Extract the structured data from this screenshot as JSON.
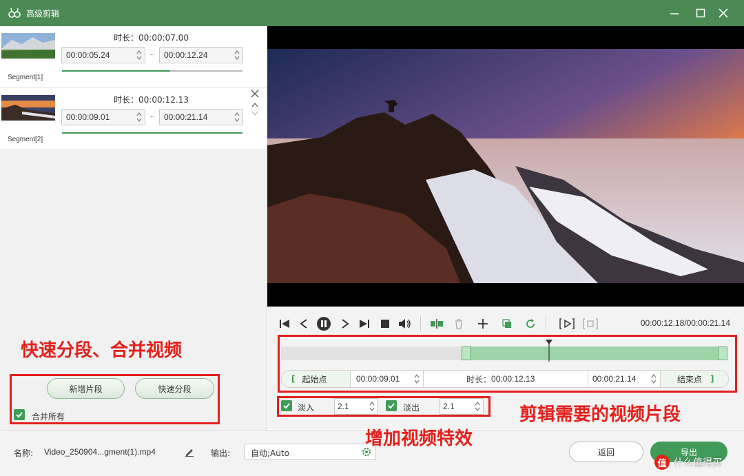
{
  "window": {
    "title": "高级剪辑"
  },
  "segments": [
    {
      "label": "Segment[1]",
      "duration_label": "时长：",
      "duration": "00:00:07.00",
      "start": "00:00:05.24",
      "end": "00:00:12.24",
      "dash": "-",
      "progress_start": 0.0,
      "progress_end": 0.6
    },
    {
      "label": "Segment[2]",
      "duration_label": "时长：",
      "duration": "00:00:12.13",
      "start": "00:00:09.01",
      "end": "00:00:21.14",
      "dash": "-",
      "progress_start": 0.0,
      "progress_end": 1.0
    }
  ],
  "left_actions": {
    "add_segment": "新增片段",
    "quick_split": "快速分段",
    "merge_all": "合并所有",
    "merge_all_checked": true
  },
  "annotations": {
    "quick_split_merge": "快速分段、合并视频",
    "clip_segment": "剪辑需要的视频片段",
    "add_effects": "增加视频特效"
  },
  "player": {
    "time_readout": "00:00:12.18/00:00:21.14",
    "selection_start_fraction": 0.405,
    "selection_end_fraction": 1.0,
    "playhead_fraction": 0.6
  },
  "markers": {
    "start_label": "起始点",
    "start_bracket": "[",
    "start_time": "00:00:09.01",
    "duration_label": "时长：",
    "duration": "00:00:12.13",
    "end_time": "00:00:21.14",
    "end_label": "结束点",
    "end_bracket": "]"
  },
  "effects": {
    "fade_in_label": "淡入",
    "fade_in_value": "2.1",
    "fade_in_checked": true,
    "fade_out_label": "淡出",
    "fade_out_value": "2.1",
    "fade_out_checked": true
  },
  "footer": {
    "name_label": "名称:",
    "file_name": "Video_250904...gment(1).mp4",
    "output_label": "输出:",
    "output_value": "自动;Auto",
    "back_button": "返回",
    "export_button": "导出",
    "watermark": "什么值得买"
  },
  "colors": {
    "titlebar": "#4b8a55",
    "accent": "#3f9b57",
    "annotation": "#e3201b"
  },
  "icons": [
    "app-logo-icon",
    "minimize-icon",
    "maximize-icon",
    "close-icon",
    "go-start-icon",
    "prev-frame-icon",
    "pause-icon",
    "next-frame-icon",
    "go-end-icon",
    "stop-icon",
    "volume-icon",
    "split-icon",
    "delete-icon",
    "add-icon",
    "copy-icon",
    "rotate-icon",
    "play-selection-icon",
    "crop-icon",
    "edit-icon",
    "settings-icon"
  ]
}
